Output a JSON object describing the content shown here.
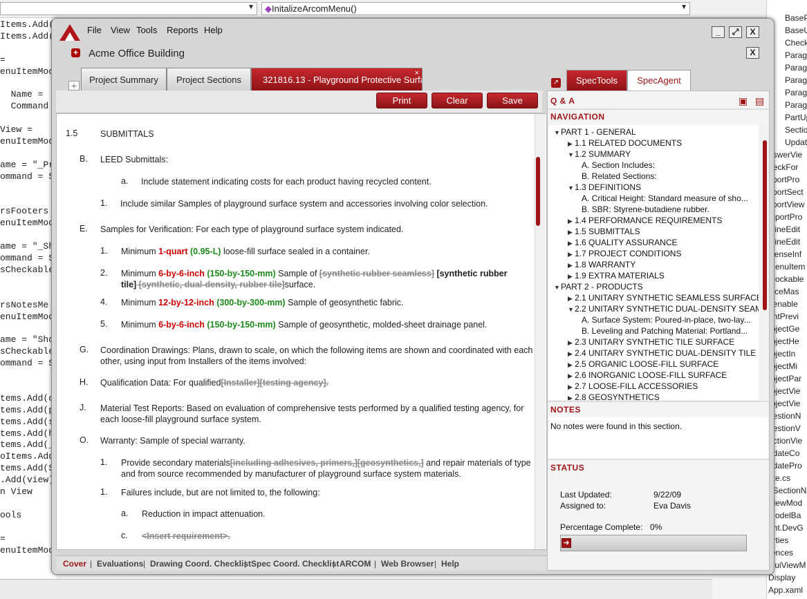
{
  "ide": {
    "combo_left": "",
    "combo_right": "InitalizeArcomMenu()",
    "code_lines": [
      "Items.Add(",
      "Items.Add(",
      "",
      "=",
      "enuItemMod",
      "",
      "  Name =",
      "  Command",
      "",
      "View =",
      "enuItemMod",
      "",
      "ame = \"_Pr",
      "ommand = S",
      "",
      "",
      "rsFooters",
      "enuItemMod",
      "",
      "ame = \"_Sh",
      "ommand = S",
      "sCheckable",
      "",
      "",
      "rsNotesMe",
      "enuItemMod",
      "",
      "ame = \"Sho",
      "sCheckable",
      "ommand = S",
      "",
      "",
      "tems.Add(c",
      "tems.Add(p",
      "tems.Add(s",
      "tems.Add(h",
      "tems.Add(_",
      "oItems.Add",
      "tems.Add(S",
      ".Add(view)",
      "n View",
      "",
      "ools",
      "",
      "=",
      "enuItemMode"
    ],
    "solution_items": [
      "BasePa",
      "BaseU",
      "Check",
      "Paragr",
      "Paragr",
      "Paragr",
      "Paragr",
      "Paragr",
      "PartUp",
      "Sectio",
      "Updat",
      "nswerVie",
      "heckFor",
      "xportPro",
      "xportSect",
      "xportView",
      "mportPro",
      "nlineEdit",
      "nlineEdit",
      "icenseInf",
      "MenuItem",
      "Mockable",
      "fficeMas",
      "penable",
      "rintPrevi",
      "rojectGe",
      "rojectHe",
      "rojectIn",
      "rojectMi",
      "rojectPar",
      "rojectVie",
      "rojectVie",
      "uestionN",
      "uestionV",
      "ectionVie",
      "pdateCo",
      "pdatePro",
      "ute.cs",
      "nSectionN",
      "ViewMod",
      "ModelBa",
      "ent.DevG",
      "erties",
      "rences",
      "GuiViewM",
      "Display",
      "App.xaml"
    ]
  },
  "window": {
    "menu": [
      "File",
      "View",
      "Tools",
      "Reports",
      "Help"
    ],
    "doc_title": "Acme Office Building",
    "tabs": [
      "Project Summary",
      "Project Sections",
      "321816.13 - Playground Protective Surfa"
    ],
    "tab_close": "×",
    "add_tab": "+",
    "buttons": {
      "print": "Print",
      "clear": "Clear",
      "save": "Save"
    },
    "min": "_",
    "restore": "⤢",
    "close": "X",
    "doc_close": "X"
  },
  "document": {
    "section_num": "1.5",
    "section_title": "SUBMITTALS",
    "b_num": "B.",
    "b_text": "LEED Submittals:",
    "ba_num": "a.",
    "ba_text": "Include statement indicating costs for each product having recycled content.",
    "b1_num": "1.",
    "b1_text": "Include similar Samples of playground surface system and accessories involving color selection.",
    "e_num": "E.",
    "e_text": "Samples for Verification: For each type of playground surface system indicated.",
    "e1_num": "1.",
    "e1_pre": "Minimum ",
    "e1_red": "1-quart",
    "e1_grn": " (0.95-L)",
    "e1_post": " loose-fill surface sealed in a container.",
    "e2_num": "2.",
    "e2_pre": "Minimum ",
    "e2_red": "6-by-6-inch",
    "e2_grn": " (150-by-150-mm)",
    "e2_mid": "  Sample of ",
    "e2_strk1": "[synthetic rubber seamless]",
    "e2_bold": " [synthetic rubber",
    "e2_bold2": "tile]",
    "e2_strk2": " [synthetic, dual-density, rubber tile]",
    "e2_post": "surface.",
    "e4_num": "4.",
    "e4_pre": "Minimum ",
    "e4_red": "12-by-12-inch",
    "e4_grn": " (300-by-300-mm)",
    "e4_post": " Sample of geosynthetic fabric.",
    "e5_num": "5.",
    "e5_pre": "Minimum ",
    "e5_red": "6-by-6-inch",
    "e5_grn": " (150-by-150-mm)",
    "e5_post": " Sample of geosynthetic, molded-sheet drainage panel.",
    "g_num": "G.",
    "g_text1": "Coordination Drawings: Plans, drawn to scale, on which the following items are shown and coordinated with each",
    "g_text2": "other, using input from Installers of the items involved:",
    "h_num": "H.",
    "h_pre": "Qualification Data: For qualified",
    "h_strk": "[Installer][testing agency].",
    "j_num": "J.",
    "j_text1": "Material Test Reports: Based on evaluation of comprehensive tests performed by a qualified testing agency, for",
    "j_text2": "each loose-fill playground surface system.",
    "o_num": "O.",
    "o_text": "Warranty: Sample of special warranty.",
    "o1_num": "1.",
    "o1_pre": "Provide secondary materials",
    "o1_strk": "[including adhesives, primers,][geosynthetics,]",
    "o1_post": " and repair materials of type",
    "o1_text2": "and from source recommended by manufacturer of playground surface system materials.",
    "o1b_num": "1.",
    "o1b_text": "Failures include, but are not limited to, the following:",
    "oa_num": "a.",
    "oa_text": "Reduction in impact attenuation.",
    "oc_num": "c.",
    "oc_text": "<Insert requirement>."
  },
  "bottom_links": [
    "Cover",
    "Evaluations",
    "Drawing Coord. Checklist",
    "Spec Coord. Checklist",
    "ARCOM",
    "Web Browser",
    "Help"
  ],
  "bottom_sep": "|",
  "right": {
    "tabs": [
      "SpecTools",
      "SpecAgent"
    ],
    "qa": "Q & A",
    "navigation": "NAVIGATION",
    "nav": [
      {
        "t": "PART 1 - GENERAL",
        "lvl": 0,
        "exp": "open"
      },
      {
        "t": "1.1 RELATED DOCUMENTS",
        "lvl": 1,
        "exp": "closed"
      },
      {
        "t": "1.2 SUMMARY",
        "lvl": 1,
        "exp": "open"
      },
      {
        "t": "A. Section Includes:",
        "lvl": 2,
        "exp": ""
      },
      {
        "t": "B. Related Sections:",
        "lvl": 2,
        "exp": ""
      },
      {
        "t": "1.3 DEFINITIONS",
        "lvl": 1,
        "exp": "open"
      },
      {
        "t": "A. Critical Height: Standard measure of sho...",
        "lvl": 2,
        "exp": ""
      },
      {
        "t": "B. SBR: Styrene-butadiene rubber.",
        "lvl": 2,
        "exp": ""
      },
      {
        "t": "1.4 PERFORMANCE REQUIREMENTS",
        "lvl": 1,
        "exp": "closed"
      },
      {
        "t": "1.5 SUBMITTALS",
        "lvl": 1,
        "exp": "closed"
      },
      {
        "t": "1.6 QUALITY ASSURANCE",
        "lvl": 1,
        "exp": "closed"
      },
      {
        "t": "1.7 PROJECT CONDITIONS",
        "lvl": 1,
        "exp": "closed"
      },
      {
        "t": "1.8 WARRANTY",
        "lvl": 1,
        "exp": "closed"
      },
      {
        "t": "1.9 EXTRA MATERIALS",
        "lvl": 1,
        "exp": "closed"
      },
      {
        "t": "PART 2 - PRODUCTS",
        "lvl": 0,
        "exp": "open"
      },
      {
        "t": "2.1 UNITARY SYNTHETIC SEAMLESS SURFACE",
        "lvl": 1,
        "exp": "closed"
      },
      {
        "t": "2.2 UNITARY SYNTHETIC DUAL-DENSITY SEAM...",
        "lvl": 1,
        "exp": "open"
      },
      {
        "t": "A. Surface System: Poured-in-place, two-lay...",
        "lvl": 2,
        "exp": ""
      },
      {
        "t": "B. Leveling and Patching Material: Portland...",
        "lvl": 2,
        "exp": ""
      },
      {
        "t": "2.3 UNITARY SYNTHETIC TILE SURFACE",
        "lvl": 1,
        "exp": "closed"
      },
      {
        "t": "2.4 UNITARY SYNTHETIC DUAL-DENSITY TILE S...",
        "lvl": 1,
        "exp": "closed"
      },
      {
        "t": "2.5 ORGANIC LOOSE-FILL SURFACE",
        "lvl": 1,
        "exp": "closed"
      },
      {
        "t": "2.6 INORGANIC LOOSE-FILL SURFACE",
        "lvl": 1,
        "exp": "closed"
      },
      {
        "t": "2.7 LOOSE-FILL ACCESSORIES",
        "lvl": 1,
        "exp": "closed"
      },
      {
        "t": "2.8 GEOSYNTHETICS",
        "lvl": 1,
        "exp": "closed"
      }
    ],
    "notes": "NOTES",
    "notes_text": "No notes were found in this section.",
    "status": "STATUS",
    "last_updated_label": "Last Updated:",
    "last_updated": "9/22/09",
    "assigned_label": "Assigned to:",
    "assigned": "Eva Davis",
    "pct_label": "Percentage Complete:",
    "pct": "0%",
    "progress_value": 0
  },
  "colors": {
    "accent": "#a01418",
    "green": "#1a8a1a",
    "red": "#d10000"
  }
}
